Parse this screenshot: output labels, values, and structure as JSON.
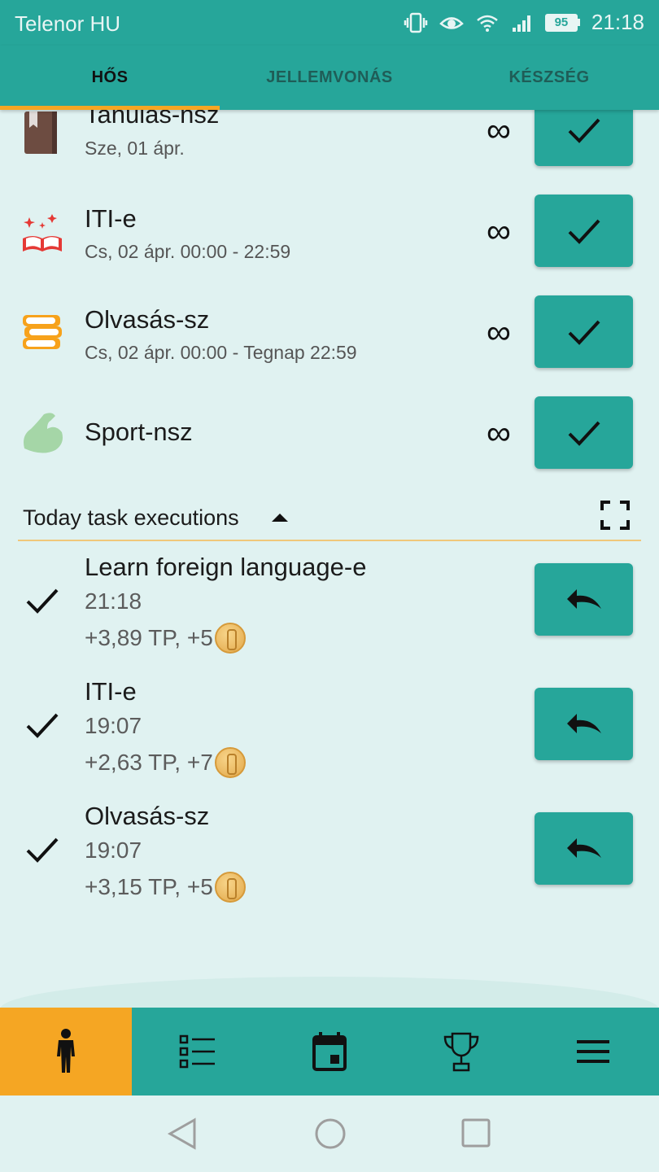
{
  "status_bar": {
    "carrier": "Telenor HU",
    "battery": "95",
    "time": "21:18",
    "icons": [
      "vibrate-icon",
      "eye-icon",
      "wifi-icon",
      "signal-icon",
      "battery-icon"
    ]
  },
  "tabs": [
    {
      "label": "HŐS",
      "active": true
    },
    {
      "label": "JELLEMVONÁS",
      "active": false
    },
    {
      "label": "KÉSZSÉG",
      "active": false
    }
  ],
  "tasks": [
    {
      "title": "Tanulás-nsz",
      "subtitle": "Sze, 01 ápr.",
      "icon": "book-icon",
      "repeat": "∞"
    },
    {
      "title": "ITI-e",
      "subtitle": "Cs, 02 ápr. 00:00 - 22:59",
      "icon": "open-book-icon",
      "repeat": "∞"
    },
    {
      "title": "Olvasás-sz",
      "subtitle": "Cs, 02 ápr. 00:00 - Tegnap 22:59",
      "icon": "books-stack-icon",
      "repeat": "∞"
    },
    {
      "title": "Sport-nsz",
      "subtitle": "",
      "icon": "muscle-icon",
      "repeat": "∞"
    }
  ],
  "executions_section": {
    "label": "Today task executions"
  },
  "executions": [
    {
      "title": "Learn foreign language-e",
      "time": "21:18",
      "reward": "+3,89 TP, +5"
    },
    {
      "title": "ITI-e",
      "time": "19:07",
      "reward": "+2,63 TP, +7"
    },
    {
      "title": "Olvasás-sz",
      "time": "19:07",
      "reward": "+3,15 TP, +5"
    }
  ],
  "bottom_nav": [
    {
      "icon": "hero-person-icon",
      "active": true
    },
    {
      "icon": "task-list-icon",
      "active": false
    },
    {
      "icon": "calendar-icon",
      "active": false
    },
    {
      "icon": "trophy-icon",
      "active": false
    },
    {
      "icon": "menu-icon",
      "active": false
    }
  ],
  "colors": {
    "primary": "#26a69a",
    "accent": "#f5a623",
    "background": "#e0f2f1"
  }
}
